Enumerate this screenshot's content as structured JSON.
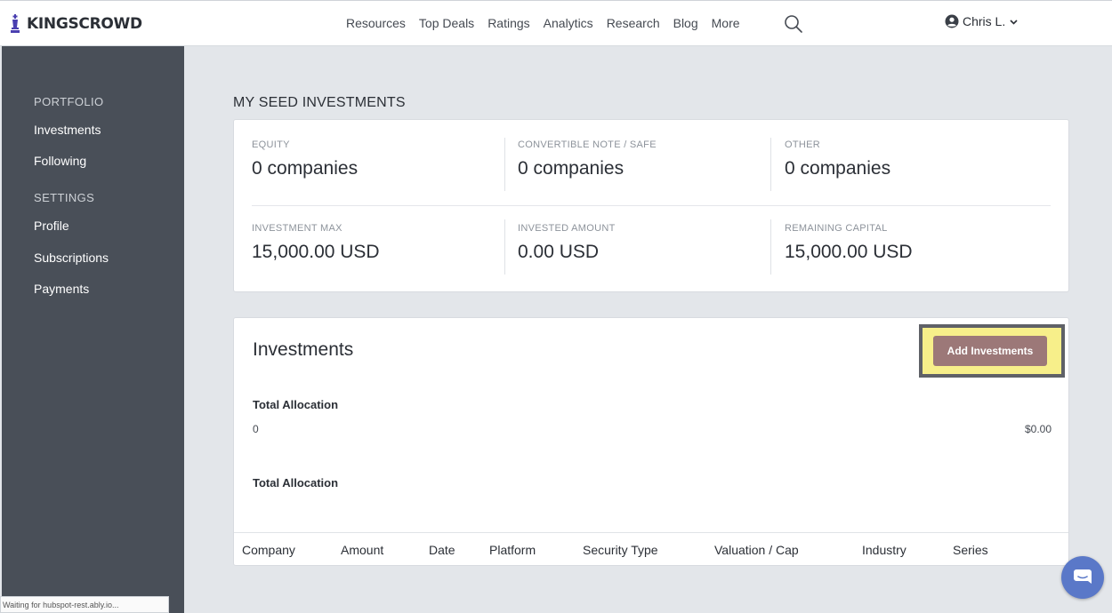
{
  "header": {
    "logo_text": "KINGSCROWD",
    "nav": [
      "Resources",
      "Top Deals",
      "Ratings",
      "Analytics",
      "Research",
      "Blog",
      "More"
    ],
    "user_name": "Chris L."
  },
  "sidebar": {
    "sections": [
      {
        "heading": "PORTFOLIO",
        "items": [
          "Investments",
          "Following"
        ]
      },
      {
        "heading": "SETTINGS",
        "items": [
          "Profile",
          "Subscriptions",
          "Payments"
        ]
      }
    ]
  },
  "status_bar": "Waiting for hubspot-rest.ably.io...",
  "main": {
    "section_title": "MY SEED INVESTMENTS",
    "stats": [
      {
        "label": "EQUITY",
        "value": "0 companies"
      },
      {
        "label": "CONVERTIBLE NOTE / SAFE",
        "value": "0 companies"
      },
      {
        "label": "OTHER",
        "value": "0 companies"
      },
      {
        "label": "INVESTMENT MAX",
        "value": "15,000.00 USD"
      },
      {
        "label": "INVESTED AMOUNT",
        "value": "0.00 USD"
      },
      {
        "label": "REMAINING CAPITAL",
        "value": "15,000.00 USD"
      }
    ],
    "investments": {
      "title": "Investments",
      "add_button": "Add Investments",
      "total_allocation_label": "Total Allocation",
      "total_allocation_count": "0",
      "total_allocation_amount": "$0.00",
      "total_allocation_label_2": "Total Allocation",
      "columns": [
        "Company",
        "Amount",
        "Date",
        "Platform",
        "Security Type",
        "Valuation / Cap",
        "Industry",
        "Series"
      ]
    }
  },
  "colors": {
    "sidebar_bg": "#494f58",
    "page_bg": "#e3e6ea",
    "add_button_bg": "#9c7878",
    "highlight": "#f7ef8a",
    "chat_button": "#5a78c8"
  }
}
